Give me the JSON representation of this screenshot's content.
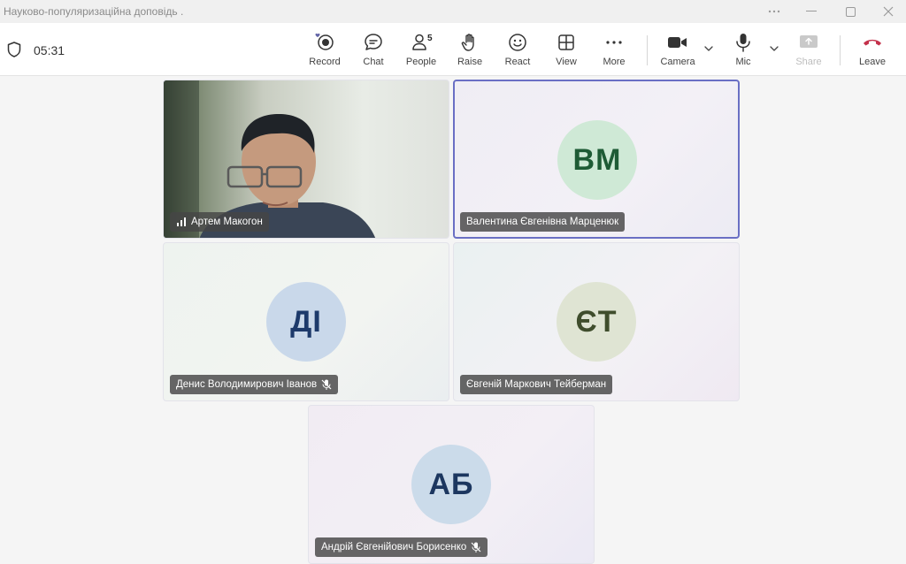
{
  "window": {
    "title": "Науково-популяризаційна доповідь ."
  },
  "toolbar": {
    "timer": "05:31",
    "buttons": {
      "record": "Record",
      "chat": "Chat",
      "people": "People",
      "people_count": "5",
      "raise": "Raise",
      "react": "React",
      "view": "View",
      "more": "More",
      "camera": "Camera",
      "mic": "Mic",
      "share": "Share",
      "leave": "Leave"
    }
  },
  "participants": [
    {
      "name": "Артем Макогон",
      "initials": "",
      "video": true,
      "muted": false,
      "active": false
    },
    {
      "name": "Валентина Євгенівна Марценюк",
      "initials": "ВМ",
      "video": false,
      "muted": false,
      "active": true
    },
    {
      "name": "Денис Володимирович Іванов",
      "initials": "ДІ",
      "video": false,
      "muted": true,
      "active": false
    },
    {
      "name": "Євгеній Маркович Тейберман",
      "initials": "ЄТ",
      "video": false,
      "muted": false,
      "active": false
    },
    {
      "name": "Андрій Євгенійович Борисенко",
      "initials": "АБ",
      "video": false,
      "muted": true,
      "active": false
    }
  ],
  "colors": {
    "active_border": "#6a6fc4",
    "leave_red": "#c4314b",
    "record_accent": "#6264a7"
  },
  "icons": [
    "shield-icon",
    "record-icon",
    "chat-icon",
    "people-icon",
    "raise-hand-icon",
    "react-icon",
    "view-icon",
    "more-icon",
    "camera-icon",
    "mic-icon",
    "share-icon",
    "leave-phone-icon",
    "mic-off-icon",
    "signal-icon",
    "chevron-down-icon"
  ]
}
